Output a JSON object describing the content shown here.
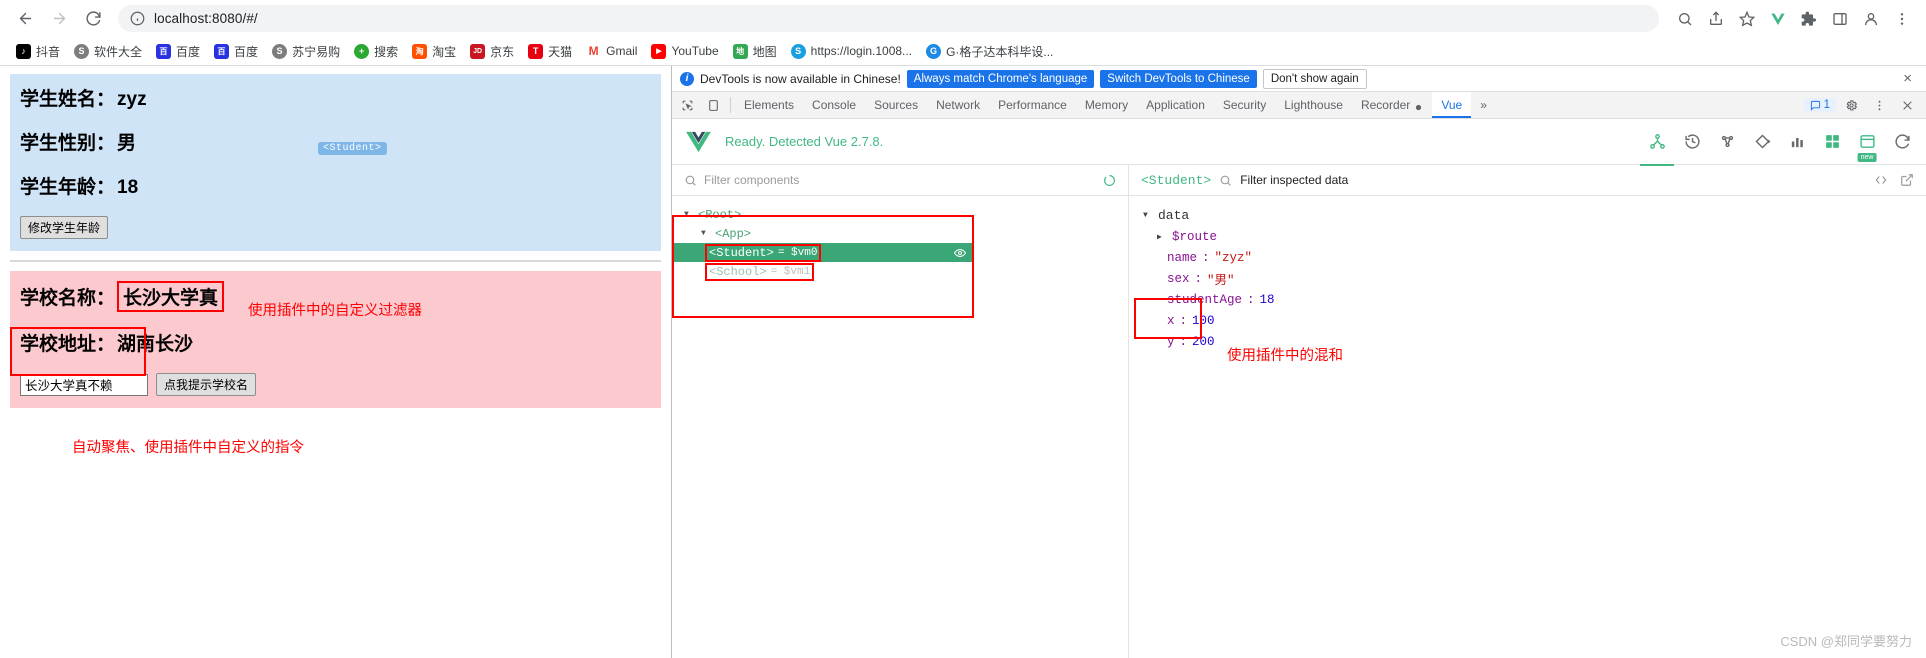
{
  "browser": {
    "url": "localhost:8080/#/",
    "nav": {
      "back": "back-arrow",
      "forward": "forward-arrow",
      "reload": "reload"
    },
    "bookmarks": [
      {
        "label": "抖音",
        "color": "#000000",
        "glyph": "♪"
      },
      {
        "label": "软件大全",
        "color": "#7d7d7d",
        "glyph": "S"
      },
      {
        "label": "百度",
        "color": "#2932e1",
        "glyph": "熊"
      },
      {
        "label": "百度",
        "color": "#2932e1",
        "glyph": "熊"
      },
      {
        "label": "苏宁易购",
        "color": "#7d7d7d",
        "glyph": "S"
      },
      {
        "label": "搜索",
        "color": "#2aa832",
        "glyph": "+"
      },
      {
        "label": "淘宝",
        "color": "#ff5000",
        "glyph": "淘"
      },
      {
        "label": "京东",
        "color": "#c81623",
        "glyph": "JD"
      },
      {
        "label": "天猫",
        "color": "#e60012",
        "glyph": "T"
      },
      {
        "label": "Gmail",
        "color": "#ea4335",
        "glyph": "M"
      },
      {
        "label": "YouTube",
        "color": "#ff0000",
        "glyph": "▶"
      },
      {
        "label": "地图",
        "color": "#34a853",
        "glyph": "📍"
      },
      {
        "label": "https://login.1008...",
        "color": "#1aa0e0",
        "glyph": "S"
      },
      {
        "label": "G·格子达本科毕设...",
        "color": "#1a8ae5",
        "glyph": "G"
      }
    ]
  },
  "webpage": {
    "student": {
      "name_label": "学生姓名：",
      "name_value": "zyz",
      "sex_label": "学生性别：",
      "sex_value": "男",
      "age_label": "学生年龄：",
      "age_value": "18",
      "button": "修改学生年龄",
      "tag": "<Student>"
    },
    "school": {
      "name_label": "学校名称：",
      "name_value": "长沙大学真",
      "addr_label": "学校地址：",
      "addr_value": "湖南长沙",
      "input_value": "长沙大学真不赖",
      "button": "点我提示学校名",
      "annotation_filter": "使用插件中的自定义过滤器"
    },
    "annotation_directive": "自动聚焦、使用插件中自定义的指令"
  },
  "devtools": {
    "banner": {
      "message": "DevTools is now available in Chinese!",
      "btn_always": "Always match Chrome's language",
      "btn_switch": "Switch DevTools to Chinese",
      "btn_dismiss": "Don't show again",
      "close": "×"
    },
    "tabs": [
      {
        "label": "Elements",
        "active": false
      },
      {
        "label": "Console",
        "active": false
      },
      {
        "label": "Sources",
        "active": false
      },
      {
        "label": "Network",
        "active": false
      },
      {
        "label": "Performance",
        "active": false
      },
      {
        "label": "Memory",
        "active": false
      },
      {
        "label": "Application",
        "active": false
      },
      {
        "label": "Security",
        "active": false
      },
      {
        "label": "Lighthouse",
        "active": false
      },
      {
        "label": "Recorder",
        "active": false
      },
      {
        "label": "Vue",
        "active": true
      }
    ],
    "overflow": "»",
    "issues_count": "1",
    "vue_panel": {
      "ready_text": "Ready. Detected Vue 2.7.8.",
      "new_badge": "new",
      "components": {
        "filter_placeholder": "Filter components",
        "tree": [
          {
            "name": "<Root>",
            "vm": "",
            "depth": 0,
            "expanded": true,
            "selected": false
          },
          {
            "name": "<App>",
            "vm": "",
            "depth": 1,
            "expanded": true,
            "selected": false
          },
          {
            "name": "<Student>",
            "vm": "= $vm0",
            "depth": 2,
            "expanded": false,
            "selected": true
          },
          {
            "name": "<School>",
            "vm": "= $vm1",
            "depth": 2,
            "expanded": false,
            "selected": false
          }
        ]
      },
      "inspector": {
        "selected_component": "<Student>",
        "filter_placeholder": "Filter inspected data",
        "group": "data",
        "entries": [
          {
            "key": "$route",
            "value": "",
            "type": "object",
            "expandable": true
          },
          {
            "key": "name",
            "value": "\"zyz\"",
            "type": "string"
          },
          {
            "key": "sex",
            "value": "\"男\"",
            "type": "string"
          },
          {
            "key": "studentAge",
            "value": "18",
            "type": "number"
          },
          {
            "key": "x",
            "value": "100",
            "type": "number"
          },
          {
            "key": "y",
            "value": "200",
            "type": "number"
          }
        ],
        "annotation_mixin": "使用插件中的混和"
      }
    }
  },
  "watermark": "CSDN @郑同学要努力"
}
